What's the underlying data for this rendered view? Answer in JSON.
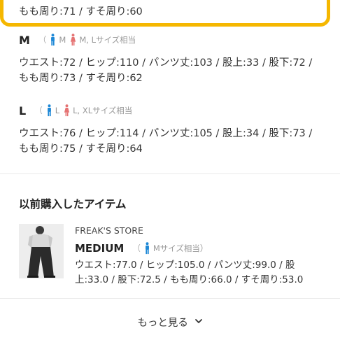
{
  "previous_size": {
    "measurements_line": "もも周り:71 / すそ周り:60"
  },
  "sizes": [
    {
      "name": "M",
      "fit_men": "M",
      "fit_women": "M, Lサイズ相当",
      "measurements_line1": "ウエスト:72 / ヒップ:110 / パンツ丈:103 / 股上:33 / 股下:72 /",
      "measurements_line2": "もも周り:73 / すそ周り:62"
    },
    {
      "name": "L",
      "fit_men": "L",
      "fit_women": "L, XLサイズ相当",
      "measurements_line1": "ウエスト:76 / ヒップ:114 / パンツ丈:105 / 股上:34 / 股下:73 /",
      "measurements_line2": "もも周り:75 / すそ周り:64"
    }
  ],
  "fit_paren_open": "（",
  "previously_purchased": {
    "title": "以前購入したアイテム",
    "item": {
      "brand": "FREAK'S STORE",
      "size_name": "MEDIUM",
      "fit_men": "Mサイズ相当）",
      "measurements_line1": "ウエスト:77.0 / ヒップ:105.0 / パンツ丈:99.0 / 股",
      "measurements_line2": "上:33.0 / 股下:72.5 / もも周り:66.0 / すそ周り:53.0"
    }
  },
  "show_more_label": "もっと見る",
  "colors": {
    "highlight": "#f5b700",
    "men_icon": "#1e88d6",
    "women_icon": "#e57373"
  },
  "icons": [
    "men-icon",
    "women-icon",
    "chevron-down-icon"
  ]
}
